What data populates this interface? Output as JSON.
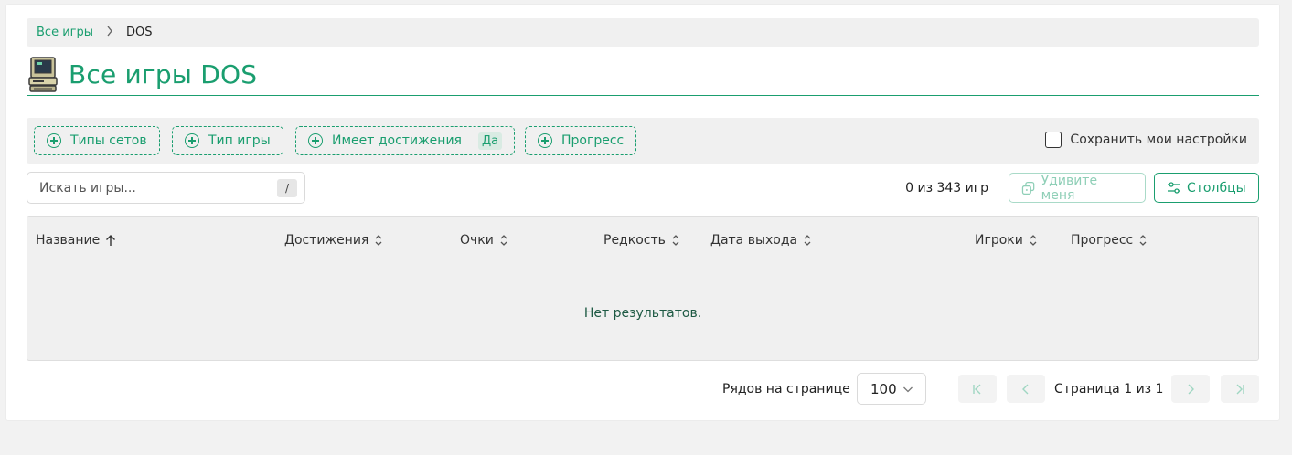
{
  "breadcrumb": {
    "root": "Все игры",
    "current": "DOS"
  },
  "page": {
    "title": "Все игры DOS"
  },
  "filters": {
    "chips": [
      {
        "label": "Типы сетов"
      },
      {
        "label": "Тип игры"
      },
      {
        "label": "Имеет достижения",
        "value": "Да"
      },
      {
        "label": "Прогресс"
      }
    ],
    "save_settings_label": "Сохранить мои настройки",
    "save_settings_checked": false
  },
  "search": {
    "placeholder": "Искать игры...",
    "shortcut": "/"
  },
  "results": {
    "count_text": "0 из 343 игр"
  },
  "toolbar": {
    "surprise_label": "Удивите меня",
    "columns_label": "Столбцы"
  },
  "table": {
    "columns": [
      "Название",
      "Достижения",
      "Очки",
      "Редкость",
      "Дата выхода",
      "Игроки",
      "Прогресс"
    ],
    "sorted_column": "Название",
    "empty_text": "Нет результатов."
  },
  "pagination": {
    "rows_label": "Рядов на странице",
    "rows_value": "100",
    "page_text": "Страница 1 из 1"
  },
  "colors": {
    "accent": "#1a9e6f",
    "panel": "#f0f0f0"
  }
}
